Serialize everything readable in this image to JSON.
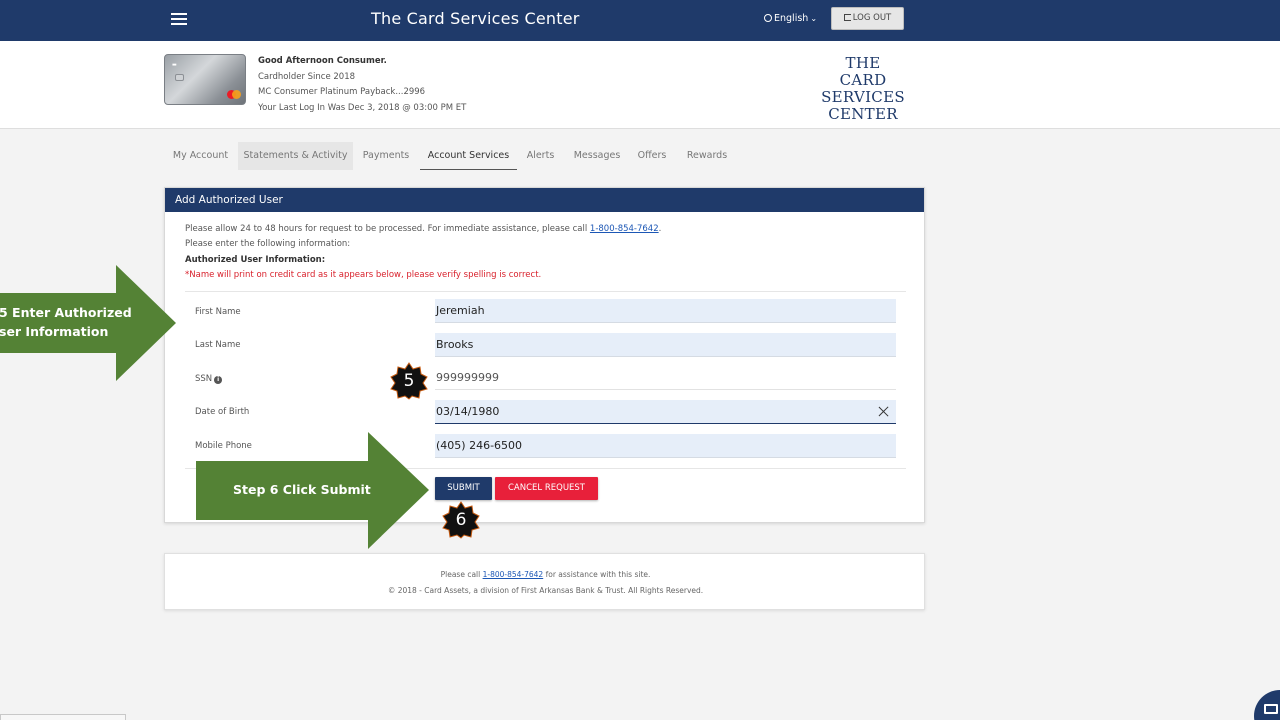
{
  "topbar": {
    "title": "The Card Services Center",
    "language": "English",
    "logout_label": "LOG OUT"
  },
  "header": {
    "greeting": "Good Afternoon Consumer.",
    "cardholder_since": "Cardholder Since 2018",
    "account_name": "MC Consumer Platinum Payback...2996",
    "last_login": "Your Last Log In Was Dec 3, 2018 @ 03:00 PM ET",
    "logo_line1": "THE",
    "logo_line2": "CARD SERVICES",
    "logo_line3": "CENTER"
  },
  "tabs": [
    {
      "label": "My Account"
    },
    {
      "label": "Statements & Activity"
    },
    {
      "label": "Payments"
    },
    {
      "label": "Account Services"
    },
    {
      "label": "Alerts"
    },
    {
      "label": "Messages"
    },
    {
      "label": "Offers"
    },
    {
      "label": "Rewards"
    }
  ],
  "panel": {
    "title": "Add Authorized User",
    "notice_prefix": "Please allow 24 to 48 hours for request to be processed. For immediate assistance, please call ",
    "notice_phone": "1-800-854-7642",
    "notice_suffix": ".",
    "instruction": "Please enter the following information:",
    "section_title": "Authorized User Information:",
    "warning": "*Name will print on credit card as it appears below, please verify spelling is correct.",
    "fields": [
      {
        "label": "First Name",
        "value": "Jeremiah"
      },
      {
        "label": "Last Name",
        "value": "Brooks"
      },
      {
        "label": "SSN",
        "value": "999999999"
      },
      {
        "label": "Date of Birth",
        "value": "03/14/1980"
      },
      {
        "label": "Mobile Phone",
        "value": "(405) 246-6500"
      }
    ],
    "submit_label": "SUBMIT",
    "cancel_label": "CANCEL REQUEST"
  },
  "footer": {
    "line1_prefix": "Please call ",
    "line1_phone": "1-800-854-7642",
    "line1_suffix": " for assistance with this site.",
    "line2": "© 2018 - Card Assets, a division of First Arkansas Bank & Trust. All Rights Reserved."
  },
  "annotations": {
    "step5_line1": "5 Enter Authorized",
    "step5_line2": "ser Information",
    "step5_badge": "5",
    "step6_label": "Step 6 Click Submit",
    "step6_badge": "6",
    "arrow_color": "#548235"
  },
  "colors": {
    "navy": "#1f3a6a",
    "danger": "#e8203a",
    "field_bg": "#e6eef9"
  }
}
